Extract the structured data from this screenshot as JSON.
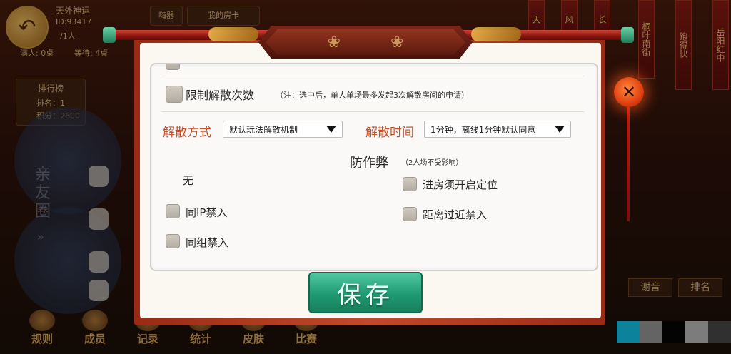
{
  "background": {
    "user_name": "天外神运",
    "user_id": "ID:93417",
    "members": "/1人",
    "stats_left": "满人: 0桌",
    "stats_right": "等待: 4桌",
    "btn_my_room": "我的房卡",
    "btn_gift": "嗨器",
    "leaderboard": {
      "title": "排行榜",
      "rank": "排名：1",
      "score": "积分：2600"
    },
    "friends_circle": "亲友圈",
    "right_strips": [
      "天",
      "风",
      "长",
      "桐叶南街",
      "跑得快",
      "岳阳红中"
    ],
    "right_tabs": [
      "谢音",
      "排名"
    ],
    "bottom_nav": [
      {
        "label": "规则",
        "icon": "question-icon"
      },
      {
        "label": "成员",
        "icon": "members-icon"
      },
      {
        "label": "记录",
        "icon": "record-icon"
      },
      {
        "label": "统计",
        "icon": "stats-icon"
      },
      {
        "label": "皮肤",
        "icon": "skin-icon"
      },
      {
        "label": "比赛",
        "icon": "match-icon"
      }
    ]
  },
  "dialog": {
    "limit_dissolve": {
      "label": "限制解散次数",
      "note": "（注：选中后，单人单场最多发起3次解散房间的申请）",
      "checked": false
    },
    "dissolve_method": {
      "label": "解散方式",
      "selected": "默认玩法解散机制"
    },
    "dissolve_time": {
      "label": "解散时间",
      "selected": "1分钟，离线1分钟默认同意"
    },
    "anti_cheat": {
      "title": "防作弊",
      "subtitle": "（2人场不受影响）"
    },
    "none_label": "无",
    "options_left": [
      {
        "label": "同IP禁入",
        "checked": false
      },
      {
        "label": "同组禁入",
        "checked": false
      }
    ],
    "options_right": [
      {
        "label": "进房须开启定位",
        "checked": false
      },
      {
        "label": "距离过近禁入",
        "checked": false
      }
    ],
    "save_label": "保存"
  },
  "colors": {
    "accent_orange": "#c5522a",
    "save_green": "#1f9a72",
    "frame_red": "#9a2a14",
    "close_orange": "#e04010"
  }
}
